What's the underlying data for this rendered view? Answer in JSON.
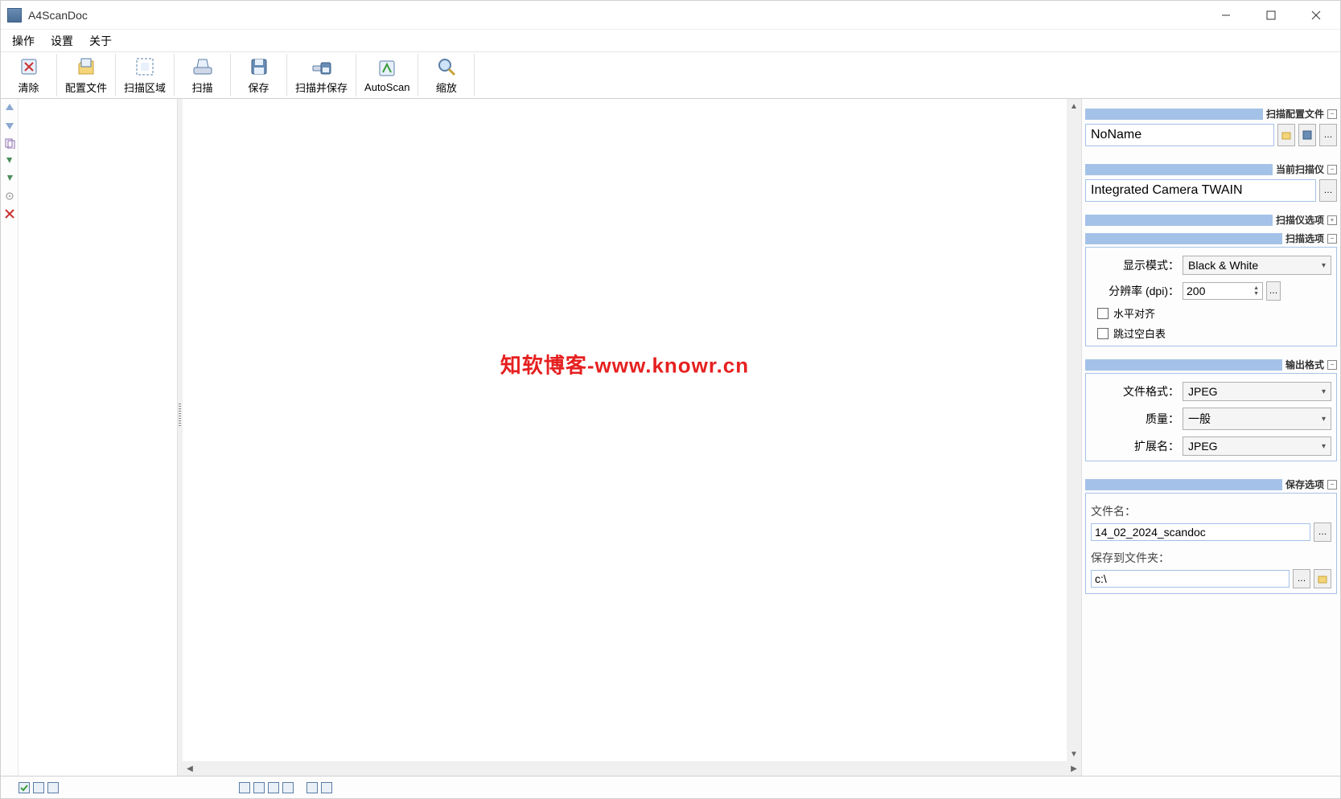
{
  "titlebar": {
    "title": "A4ScanDoc"
  },
  "menubar": {
    "items": [
      "操作",
      "设置",
      "关于"
    ]
  },
  "toolbar": {
    "clear": "清除",
    "profile": "配置文件",
    "scan_area": "扫描区域",
    "scan": "扫描",
    "save": "保存",
    "scan_and_save": "扫描并保存",
    "autoscan": "AutoScan",
    "zoom": "缩放"
  },
  "watermark": "知软博客-www.knowr.cn",
  "right": {
    "scan_profile_header": "扫描配置文件",
    "profile_name": "NoName",
    "current_scanner_header": "当前扫描仪",
    "scanner_name": "Integrated Camera TWAIN",
    "scanner_options_header": "扫描仪选项",
    "scan_options_header": "扫描选项",
    "display_mode_label": "显示模式：",
    "display_mode_value": "Black & White",
    "dpi_label": "分辨率 (dpi)：",
    "dpi_value": "200",
    "horiz_align": "水平对齐",
    "skip_blank": "跳过空白表",
    "output_format_header": "输出格式",
    "file_format_label": "文件格式：",
    "file_format_value": "JPEG",
    "quality_label": "质量：",
    "quality_value": "一般",
    "extension_label": "扩展名：",
    "extension_value": "JPEG",
    "save_options_header": "保存选项",
    "filename_label": "文件名：",
    "filename_value": "14_02_2024_scandoc",
    "folder_label": "保存到文件夹：",
    "folder_value": "c:\\"
  }
}
